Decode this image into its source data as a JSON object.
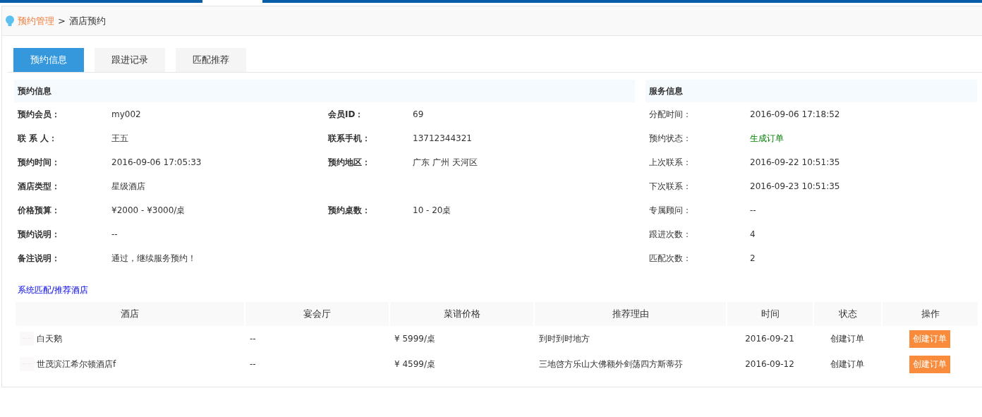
{
  "breadcrumb": {
    "parent": "预约管理",
    "separator": ">",
    "current": "酒店预约"
  },
  "tabs": [
    {
      "label": "预约信息",
      "selected": true
    },
    {
      "label": "跟进记录",
      "selected": false
    },
    {
      "label": "匹配推荐",
      "selected": false
    }
  ],
  "booking_info": {
    "title": "预约信息",
    "rows": [
      {
        "fields": [
          {
            "label": "预约会员：",
            "value": "my002"
          },
          {
            "label": "会员ID：",
            "value": "69"
          }
        ]
      },
      {
        "fields": [
          {
            "label": "联 系 人：",
            "value": "王五"
          },
          {
            "label": "联系手机：",
            "value": "13712344321"
          }
        ]
      },
      {
        "fields": [
          {
            "label": "预约时间：",
            "value": "2016-09-06 17:05:33"
          },
          {
            "label": "预约地区：",
            "value": "广东 广州 天河区"
          }
        ]
      },
      {
        "fields": [
          {
            "label": "酒店类型：",
            "value": "星级酒店"
          }
        ]
      },
      {
        "fields": [
          {
            "label": "价格预算：",
            "value": "¥2000 - ¥3000/桌"
          },
          {
            "label": "预约桌数：",
            "value": "10 - 20桌"
          }
        ]
      },
      {
        "fields": [
          {
            "label": "预约说明：",
            "value": "--"
          }
        ]
      },
      {
        "fields": [
          {
            "label": "备注说明：",
            "value": "通过，继续服务预约！"
          }
        ]
      }
    ]
  },
  "service_info": {
    "title": "服务信息",
    "fields": [
      {
        "label": "分配时间：",
        "value": "2016-09-06 17:18:52",
        "kind": "text"
      },
      {
        "label": "预约状态：",
        "value": "生成订单",
        "kind": "status"
      },
      {
        "label": "上次联系：",
        "value": "2016-09-22 10:51:35",
        "kind": "text"
      },
      {
        "label": "下次联系：",
        "value": "2016-09-23 10:51:35",
        "kind": "text"
      },
      {
        "label": "专属顾问：",
        "value": "--",
        "kind": "text"
      },
      {
        "label": "跟进次数：",
        "value": "4",
        "kind": "text"
      },
      {
        "label": "匹配次数：",
        "value": "2",
        "kind": "text"
      }
    ]
  },
  "recommend_link": "系统匹配/推荐酒店",
  "table": {
    "columns": [
      "酒店",
      "宴会厅",
      "菜谱价格",
      "推荐理由",
      "时间",
      "状态",
      "操作"
    ],
    "rows": [
      {
        "hotel": "白天鹅",
        "hall": "--",
        "price": "¥ 5999/桌",
        "reason": "到时到时地方",
        "time": "2016-09-21",
        "status": "创建订单",
        "action": "创建订单"
      },
      {
        "hotel": "世茂滨江希尔顿酒店f",
        "hall": "--",
        "price": "¥ 4599/桌",
        "reason": "三地啓方乐山大佛额外剑荡四方斯蒂芬",
        "time": "2016-09-12",
        "status": "创建订单",
        "action": "创建订单"
      }
    ]
  }
}
